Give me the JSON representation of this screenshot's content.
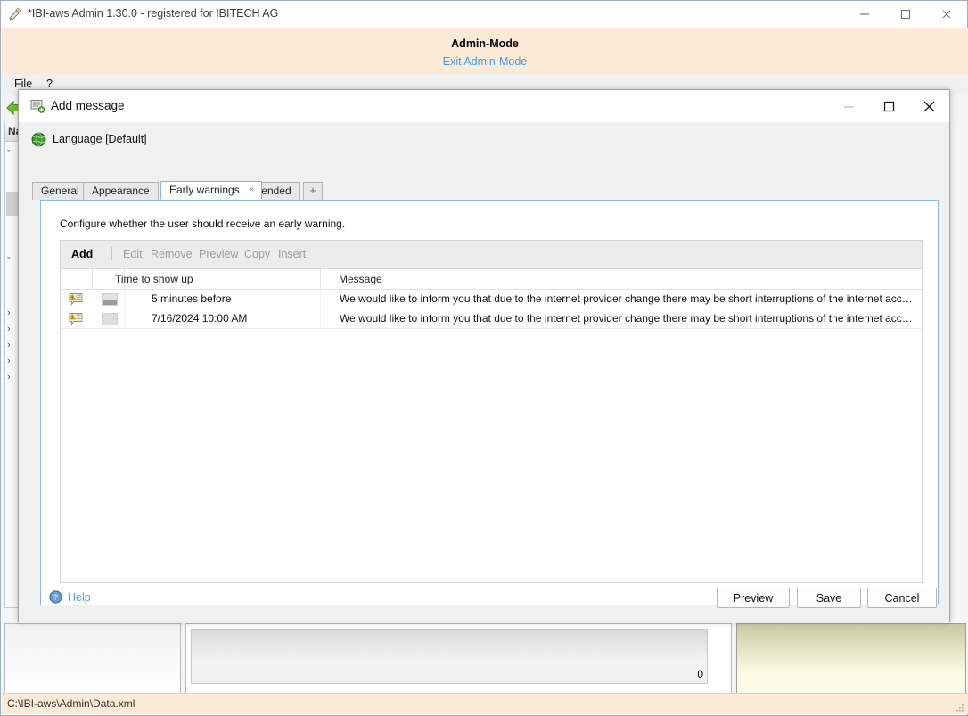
{
  "app": {
    "title": "*IBI-aws Admin 1.30.0 - registered for IBITECH AG",
    "title_icon": "pen-document-icon",
    "window_controls": {
      "minimize": "minimize-icon",
      "maximize": "maximize-icon",
      "close": "close-icon"
    },
    "admin_banner": {
      "title": "Admin-Mode",
      "exit_link": "Exit Admin-Mode"
    },
    "menubar": {
      "items": [
        {
          "label": "File"
        },
        {
          "label": "?"
        }
      ]
    },
    "nav_panel": {
      "header": "Na",
      "rows": [
        "ˇ",
        "ˇ",
        "›",
        "›",
        "›",
        "›",
        "›"
      ]
    },
    "background_grid": {
      "total": "0"
    },
    "statusbar": {
      "path": "C:\\IBI-aws\\Admin\\Data.xml"
    }
  },
  "dialog": {
    "title": "Add message",
    "title_icon": "add-message-icon",
    "window_controls": {
      "minimize": "minimize-icon",
      "maximize": "maximize-icon",
      "close": "close-icon"
    },
    "language": {
      "icon": "globe-icon",
      "label": "Language [Default]"
    },
    "tabs": [
      {
        "label": "General",
        "active": false,
        "closable": false
      },
      {
        "label": "Appearance",
        "active": false,
        "closable": false
      },
      {
        "label": "Early warnings",
        "active": true,
        "closable": true,
        "close_glyph": "×"
      },
      {
        "label": "Extended",
        "active": false,
        "closable": false
      }
    ],
    "tab_add_label": "+",
    "panel": {
      "description": "Configure whether the user should receive an early warning.",
      "toolbar": [
        {
          "label": "Add",
          "enabled": true
        },
        {
          "label": "Edit",
          "enabled": false
        },
        {
          "label": "Remove",
          "enabled": false
        },
        {
          "label": "Preview",
          "enabled": false
        },
        {
          "label": "Copy",
          "enabled": false
        },
        {
          "label": "Insert",
          "enabled": false
        }
      ],
      "columns": [
        {
          "label": ""
        },
        {
          "label": ""
        },
        {
          "label": "Time to show up"
        },
        {
          "label": "Message"
        }
      ],
      "rows": [
        {
          "icon": "warning-message-icon",
          "chip": "dark",
          "time": "5 minutes before",
          "message": "We would like to inform you that due to the internet provider change there may be short interruptions of the internet access at th…"
        },
        {
          "icon": "warning-message-icon",
          "chip": "light",
          "time": "7/16/2024 10:00 AM",
          "message": "We would like to inform you that due to the internet provider change there may be short interruptions of the internet access at th…"
        }
      ]
    },
    "footer": {
      "help_label": "Help",
      "help_icon": "help-icon",
      "buttons": [
        {
          "label": "Preview"
        },
        {
          "label": "Save"
        },
        {
          "label": "Cancel"
        }
      ]
    }
  },
  "colors": {
    "admin_band": "#fbead6",
    "link_blue": "#4a9ce8",
    "tab_active_border": "#8ab4d8",
    "status_band": "#fbead6"
  }
}
